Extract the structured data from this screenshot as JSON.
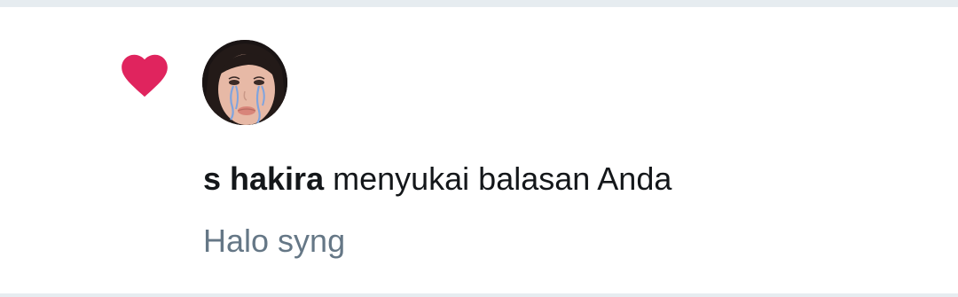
{
  "notification": {
    "type_icon": "heart-icon",
    "avatar_icon": "avatar",
    "user_name": "s hakira",
    "action_text": " menyukai balasan Anda",
    "preview_text": "Halo syng"
  },
  "colors": {
    "heart": "#e0245e",
    "primary_text": "#14171a",
    "secondary_text": "#657786",
    "divider": "#e6ecf0"
  }
}
